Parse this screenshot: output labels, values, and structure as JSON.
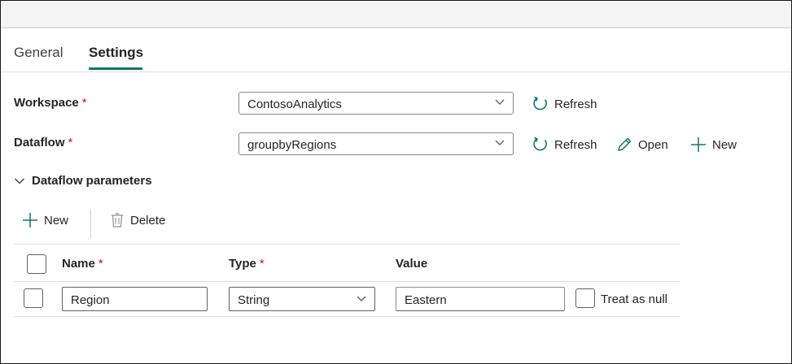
{
  "tabs": [
    {
      "label": "General",
      "active": false
    },
    {
      "label": "Settings",
      "active": true
    }
  ],
  "workspace": {
    "label": "Workspace",
    "required_mark": "*",
    "value": "ContosoAnalytics",
    "refresh_label": "Refresh"
  },
  "dataflow": {
    "label": "Dataflow",
    "required_mark": "*",
    "value": "groupbyRegions",
    "refresh_label": "Refresh",
    "open_label": "Open",
    "new_label": "New"
  },
  "parameters": {
    "section_title": "Dataflow parameters",
    "new_label": "New",
    "delete_label": "Delete",
    "columns": {
      "name": "Name",
      "type": "Type",
      "value": "Value",
      "required_mark": "*"
    },
    "rows": [
      {
        "name": "Region",
        "type": "String",
        "value": "Eastern",
        "treat_null_label": "Treat as null"
      }
    ]
  },
  "colors": {
    "accent": "#117865",
    "required": "#c50f1f",
    "border": "#8a8a8a"
  }
}
